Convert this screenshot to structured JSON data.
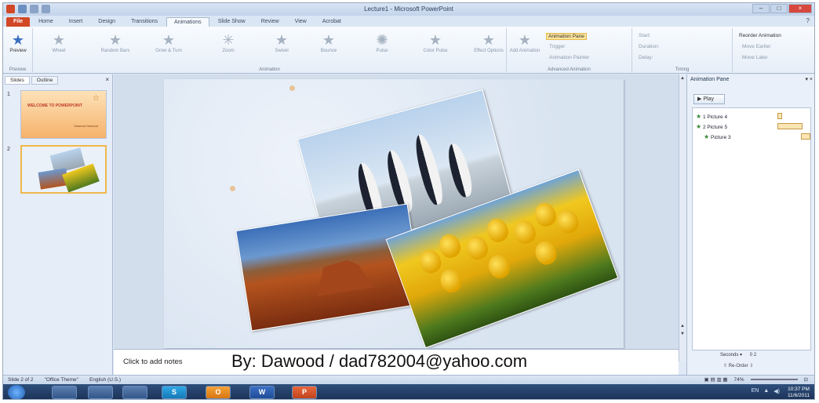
{
  "window": {
    "title": "Lecture1 - Microsoft PowerPoint",
    "minimize": "–",
    "maximize": "□",
    "close": "×"
  },
  "tabs": [
    "File",
    "Home",
    "Insert",
    "Design",
    "Transitions",
    "Animations",
    "Slide Show",
    "Review",
    "View",
    "Acrobat"
  ],
  "active_tab": "Animations",
  "ribbon": {
    "preview": "Preview",
    "animations": [
      "Wheel",
      "Random Bars",
      "Grow & Turn",
      "Zoom",
      "Swivel",
      "Bounce",
      "Pulse",
      "Color Pulse"
    ],
    "effect_options": "Effect Options",
    "add_animation": "Add Animation",
    "animation_pane": "Animation Pane",
    "trigger": "Trigger",
    "animation_painter": "Animation Painter",
    "start": "Start:",
    "duration": "Duration:",
    "delay": "Delay:",
    "reorder": "Reorder Animation",
    "move_earlier": "Move Earlier",
    "move_later": "Move Later",
    "group_preview": "Preview",
    "group_animation": "Animation",
    "group_advanced": "Advanced Animation",
    "group_timing": "Timing"
  },
  "left_panel": {
    "tab_slides": "Slides",
    "tab_outline": "Outline",
    "slide1_num": "1",
    "slide2_num": "2",
    "slide1_title": "WELCOME TO POWERPOINT",
    "slide1_sub": "Dawood Dawood"
  },
  "notes": {
    "placeholder": "Click to add notes",
    "watermark": "By: Dawood / dad782004@yahoo.com"
  },
  "animation_pane": {
    "title": "Animation Pane",
    "play": "Play",
    "items": [
      {
        "label": "1 Picture 4"
      },
      {
        "label": "2 Picture 5"
      },
      {
        "label": "Picture 3"
      }
    ],
    "seconds": "Seconds ▾",
    "scale": "0   2",
    "reorder": "Re-Order"
  },
  "status_bar": {
    "slide": "Slide 2 of 2",
    "theme": "\"Office Theme\"",
    "language": "English (U.S.)",
    "zoom": "74%"
  },
  "taskbar": {
    "apps": [
      "",
      "",
      "",
      "S",
      "O",
      "W",
      "P"
    ],
    "tray": "EN",
    "time": "10:37 PM",
    "date": "11/6/2011"
  },
  "colors": {
    "file_tab": "#d24726",
    "selection": "#f0b84c",
    "taskbar": "#1a3155"
  }
}
